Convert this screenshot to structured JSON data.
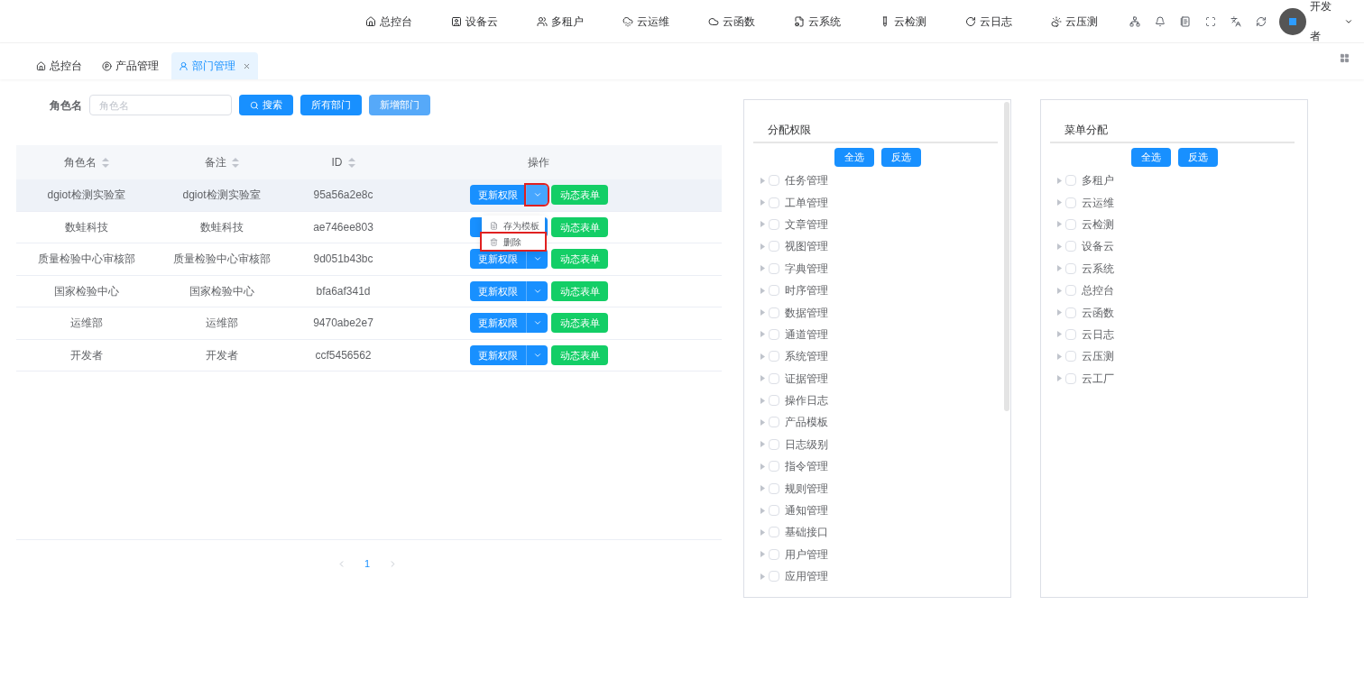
{
  "top_nav": {
    "items": [
      {
        "label": "总控台"
      },
      {
        "label": "设备云"
      },
      {
        "label": "多租户"
      },
      {
        "label": "云运维"
      },
      {
        "label": "云函数"
      },
      {
        "label": "云系统"
      },
      {
        "label": "云检测"
      },
      {
        "label": "云日志"
      },
      {
        "label": "云压测"
      }
    ],
    "user": {
      "name": "开发者"
    }
  },
  "tabs": [
    {
      "label": "总控台",
      "selected": false,
      "closable": false
    },
    {
      "label": "产品管理",
      "selected": false,
      "closable": false
    },
    {
      "label": "部门管理",
      "selected": true,
      "closable": true
    }
  ],
  "search": {
    "label": "角色名",
    "placeholder": "角色名",
    "buttons": [
      {
        "label": "搜索",
        "kind": "search"
      },
      {
        "label": "所有部门",
        "kind": "primary"
      },
      {
        "label": "新增部门",
        "kind": "light"
      }
    ]
  },
  "table": {
    "columns": [
      {
        "label": "角色名",
        "sortable": true
      },
      {
        "label": "备注",
        "sortable": true
      },
      {
        "label": "ID",
        "sortable": true
      },
      {
        "label": "操作",
        "sortable": false
      }
    ],
    "rows": [
      {
        "cells": [
          "dgiot检测实验室",
          "dgiot检测实验室",
          "95a56a2e8c"
        ],
        "highlighted": true,
        "update": "更新权限",
        "form": "动态表单",
        "toggle_marked": true,
        "menu": [
          {
            "label": "存为模板",
            "marked": false
          },
          {
            "label": "删除",
            "marked": true
          }
        ]
      },
      {
        "cells": [
          "数蛙科技",
          "数蛙科技",
          "ae746ee803"
        ],
        "highlighted": false,
        "form": "动态表单",
        "toggle_marked": false
      },
      {
        "cells": [
          "质量检验中心审核部",
          "质量检验中心审核部",
          "9d051b43bc"
        ],
        "highlighted": false,
        "update": "更新权限",
        "form": "动态表单",
        "toggle_marked": false
      },
      {
        "cells": [
          "国家检验中心",
          "国家检验中心",
          "bfa6af341d"
        ],
        "highlighted": false,
        "update": "更新权限",
        "form": "动态表单",
        "toggle_marked": false
      },
      {
        "cells": [
          "运维部",
          "运维部",
          "9470abe2e7"
        ],
        "highlighted": false,
        "update": "更新权限",
        "form": "动态表单",
        "toggle_marked": false
      },
      {
        "cells": [
          "开发者",
          "开发者",
          "ccf5456562"
        ],
        "highlighted": false,
        "update": "更新权限",
        "form": "动态表单",
        "toggle_marked": false
      }
    ]
  },
  "pagination": {
    "pages": [
      {
        "label": "1",
        "selected": true
      }
    ]
  },
  "panels": [
    {
      "title": "分配权限",
      "buttons": [
        "全选",
        "反选"
      ],
      "scrollbar": true,
      "items": [
        {
          "label": "任务管理",
          "checked": false
        },
        {
          "label": "工单管理",
          "checked": false
        },
        {
          "label": "文章管理",
          "checked": false
        },
        {
          "label": "视图管理",
          "checked": false
        },
        {
          "label": "字典管理",
          "checked": false
        },
        {
          "label": "时序管理",
          "checked": false
        },
        {
          "label": "数据管理",
          "checked": false
        },
        {
          "label": "通道管理",
          "checked": false
        },
        {
          "label": "系统管理",
          "checked": false
        },
        {
          "label": "证据管理",
          "checked": false
        },
        {
          "label": "操作日志",
          "checked": false
        },
        {
          "label": "产品模板",
          "checked": false
        },
        {
          "label": "日志级别",
          "checked": false
        },
        {
          "label": "指令管理",
          "checked": false
        },
        {
          "label": "规则管理",
          "checked": false
        },
        {
          "label": "通知管理",
          "checked": false
        },
        {
          "label": "基础接口",
          "checked": false
        },
        {
          "label": "用户管理",
          "checked": false
        },
        {
          "label": "应用管理",
          "checked": false
        }
      ]
    },
    {
      "title": "菜单分配",
      "buttons": [
        "全选",
        "反选"
      ],
      "scrollbar": false,
      "items": [
        {
          "label": "多租户",
          "checked": false
        },
        {
          "label": "云运维",
          "checked": false
        },
        {
          "label": "云检测",
          "checked": false
        },
        {
          "label": "设备云",
          "checked": false
        },
        {
          "label": "云系统",
          "checked": false
        },
        {
          "label": "总控台",
          "checked": false
        },
        {
          "label": "云函数",
          "checked": false
        },
        {
          "label": "云日志",
          "checked": false
        },
        {
          "label": "云压测",
          "checked": false
        },
        {
          "label": "云工厂",
          "checked": false
        }
      ]
    }
  ]
}
